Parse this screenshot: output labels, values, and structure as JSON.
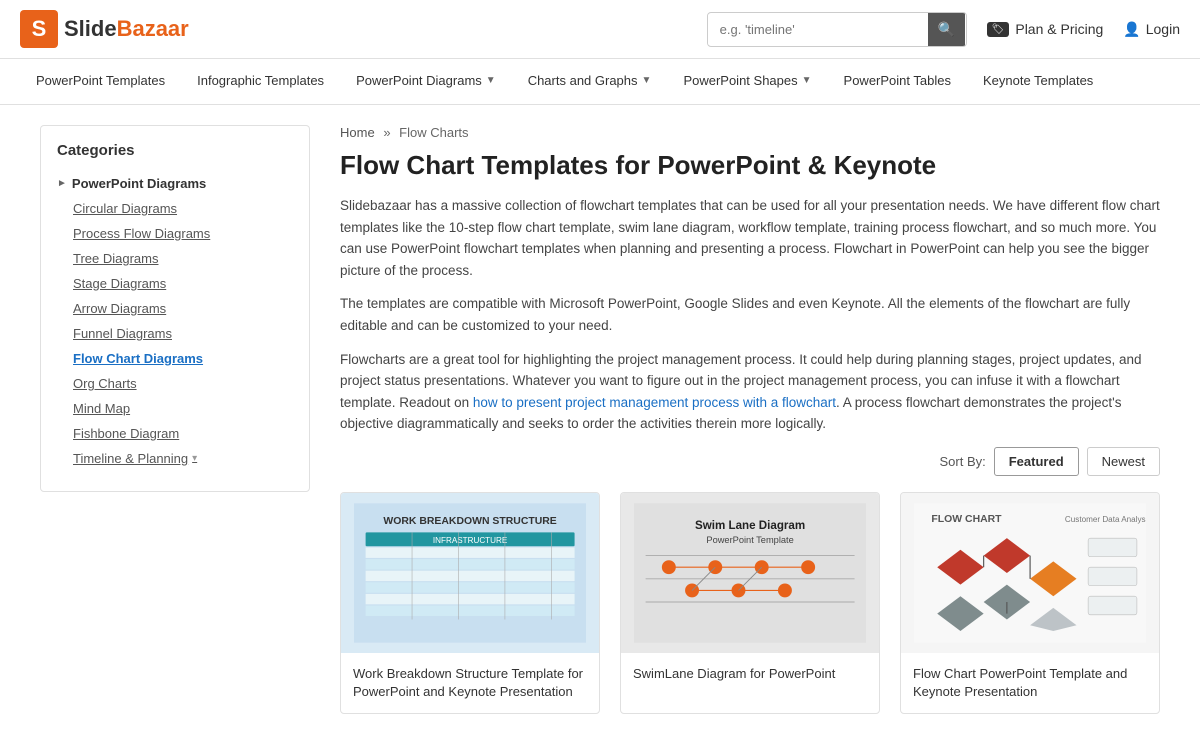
{
  "header": {
    "logo_text": "SlideBazaar",
    "logo_letter": "S",
    "search_placeholder": "e.g. 'timeline'",
    "plan_pricing_label": "Plan & Pricing",
    "login_label": "Login"
  },
  "nav": {
    "items": [
      {
        "label": "PowerPoint Templates",
        "has_dropdown": false
      },
      {
        "label": "Infographic Templates",
        "has_dropdown": false
      },
      {
        "label": "PowerPoint Diagrams",
        "has_dropdown": true
      },
      {
        "label": "Charts and Graphs",
        "has_dropdown": true
      },
      {
        "label": "PowerPoint Shapes",
        "has_dropdown": true
      },
      {
        "label": "PowerPoint Tables",
        "has_dropdown": false
      },
      {
        "label": "Keynote Templates",
        "has_dropdown": false
      }
    ]
  },
  "sidebar": {
    "title": "Categories",
    "sections": [
      {
        "label": "PowerPoint Diagrams",
        "items": [
          {
            "label": "Circular Diagrams",
            "active": false
          },
          {
            "label": "Process Flow Diagrams",
            "active": false
          },
          {
            "label": "Tree Diagrams",
            "active": false
          },
          {
            "label": "Stage Diagrams",
            "active": false
          },
          {
            "label": "Arrow Diagrams",
            "active": false
          },
          {
            "label": "Funnel Diagrams",
            "active": false
          },
          {
            "label": "Flow Chart Diagrams",
            "active": true
          },
          {
            "label": "Org Charts",
            "active": false
          },
          {
            "label": "Mind Map",
            "active": false
          },
          {
            "label": "Fishbone Diagram",
            "active": false
          },
          {
            "label": "Timeline & Planning",
            "active": false
          }
        ]
      }
    ]
  },
  "content": {
    "breadcrumb": {
      "home": "Home",
      "separator": "»",
      "current": "Flow Charts"
    },
    "page_title": "Flow Chart Templates for PowerPoint & Keynote",
    "description1": "Slidebazaar has a massive collection of flowchart templates that can be used for all your presentation needs. We have different flow chart templates like the 10-step flow chart template, swim lane diagram, workflow template, training process flowchart, and so much more. You can use PowerPoint flowchart templates when planning and presenting a process. Flowchart in PowerPoint can help you see the bigger picture of the process.",
    "description2": "The templates are compatible with Microsoft PowerPoint, Google Slides and even Keynote. All the elements of the flowchart are fully editable and can be customized to your need.",
    "description3_pre": "Flowcharts are a great tool for highlighting the project management process. It could help during planning stages, project updates, and project status presentations. Whatever you want to figure out in the project management process, you can infuse it with a flowchart template. Readout on ",
    "description3_link": "how to present project management process with a flowchart",
    "description3_post": ". A process flowchart demonstrates the project's objective diagrammatically and seeks to order the activities therein more logically.",
    "sort": {
      "label": "Sort By:",
      "options": [
        "Featured",
        "Newest"
      ]
    },
    "cards": [
      {
        "id": "card1",
        "title": "Work Breakdown Structure Template for PowerPoint and Keynote Presentation",
        "img_label": "WORK BREAKDOWN STRUCTURE"
      },
      {
        "id": "card2",
        "title": "SwimLane Diagram for PowerPoint",
        "img_label": "Swim Lane Diagram\nPowerPoint Template"
      },
      {
        "id": "card3",
        "title": "Flow Chart PowerPoint Template and Keynote Presentation",
        "img_label": "FLOW CHART"
      }
    ]
  }
}
